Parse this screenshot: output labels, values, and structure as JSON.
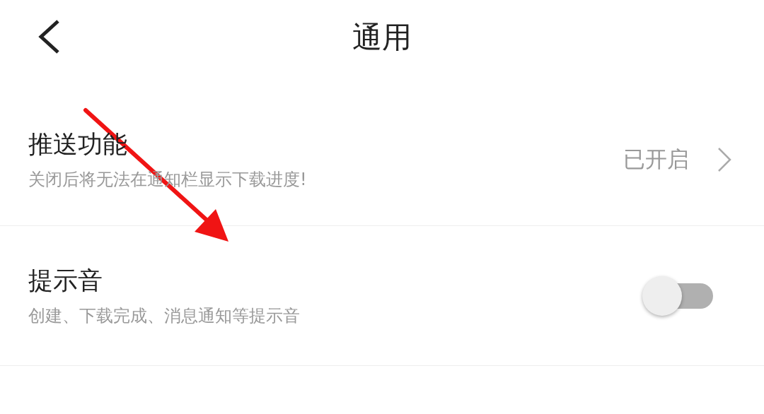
{
  "header": {
    "title": "通用"
  },
  "settings": [
    {
      "kind": "link",
      "title": "推送功能",
      "subtitle": "关闭后将无法在通知栏显示下载进度!",
      "value": "已开启"
    },
    {
      "kind": "toggle",
      "title": "提示音",
      "subtitle": "创建、下载完成、消息通知等提示音",
      "on": false
    }
  ]
}
